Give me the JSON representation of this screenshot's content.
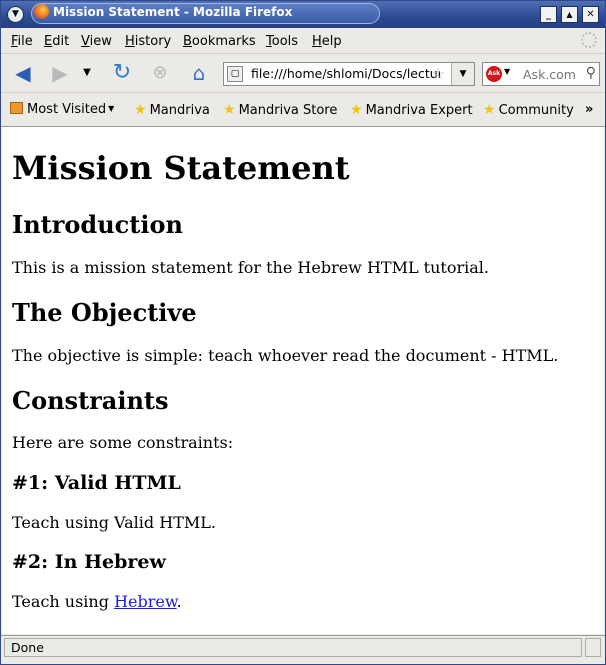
{
  "window": {
    "title": "Mission Statement - Mozilla Firefox",
    "minimize_glyph": "_",
    "maximize_glyph": "▲",
    "close_glyph": "✕",
    "menu_glyph": "▼"
  },
  "menubar": {
    "items": [
      "File",
      "Edit",
      "View",
      "History",
      "Bookmarks",
      "Tools",
      "Help"
    ]
  },
  "navbar": {
    "url": "file:///home/shlomi/Docs/lecture/",
    "search_placeholder": "Ask.com",
    "back_icon": "back-arrow-icon",
    "forward_icon": "forward-arrow-icon",
    "reload_icon": "reload-icon",
    "stop_icon": "stop-icon",
    "home_icon": "home-icon"
  },
  "bookmarks": {
    "items": [
      "Most Visited",
      "Mandriva",
      "Mandriva Store",
      "Mandriva Expert",
      "Community"
    ],
    "more_glyph": "»"
  },
  "page": {
    "h1": "Mission Statement",
    "intro_heading": "Introduction",
    "intro_text": "This is a mission statement for the Hebrew HTML tutorial.",
    "objective_heading": "The Objective",
    "objective_text": "The objective is simple: teach whoever read the document - HTML.",
    "constraints_heading": "Constraints",
    "constraints_text": "Here are some constraints:",
    "c1_heading": "#1: Valid HTML",
    "c1_text": "Teach using Valid HTML.",
    "c2_heading": "#2: In Hebrew",
    "c2_text_prefix": "Teach using ",
    "c2_link": "Hebrew",
    "c2_text_suffix": "."
  },
  "status": {
    "text": "Done"
  },
  "colors": {
    "titlebar": "#2c4a92",
    "link": "#1a1ae6",
    "chrome": "#eceae6"
  }
}
